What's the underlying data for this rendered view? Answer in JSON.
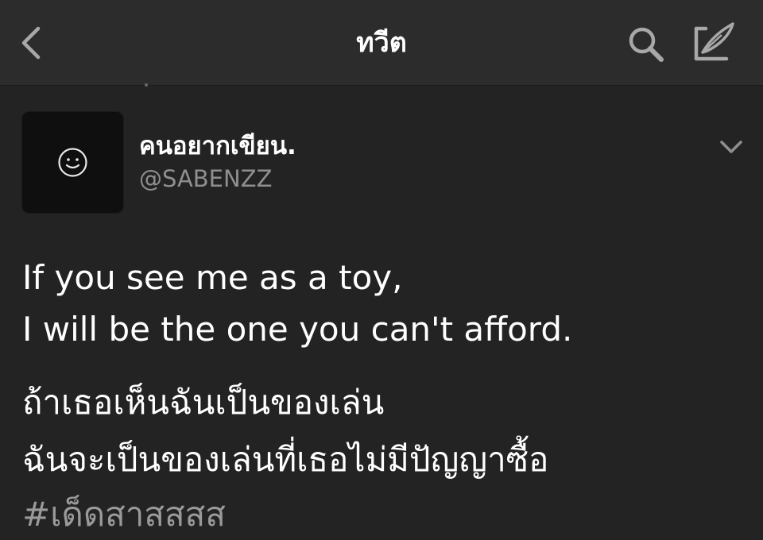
{
  "nav": {
    "title": "ทวีต",
    "back_icon": "chevron-left-icon",
    "search_icon": "search-icon",
    "compose_icon": "compose-feather-icon"
  },
  "tweet": {
    "author": {
      "display_name": "คนอยากเขียน.",
      "handle": "@SABENZZ",
      "avatar_icon": "smiley-face-icon"
    },
    "more_icon": "chevron-down-icon",
    "lines": [
      "If you see me as a toy,",
      "I will be the one you can't afford.",
      "ถ้าเธอเห็นฉันเป็นของเล่น",
      "ฉันจะเป็นของเล่นที่เธอไม่มีปัญญาซื้อ"
    ],
    "hashtag": "#เด็ดสาสสสส"
  },
  "colors": {
    "background": "#232323",
    "navbar": "#2c2c2c",
    "text_primary": "#ffffff",
    "text_secondary": "#8f8f8f",
    "hashtag": "#9a9a9a"
  }
}
